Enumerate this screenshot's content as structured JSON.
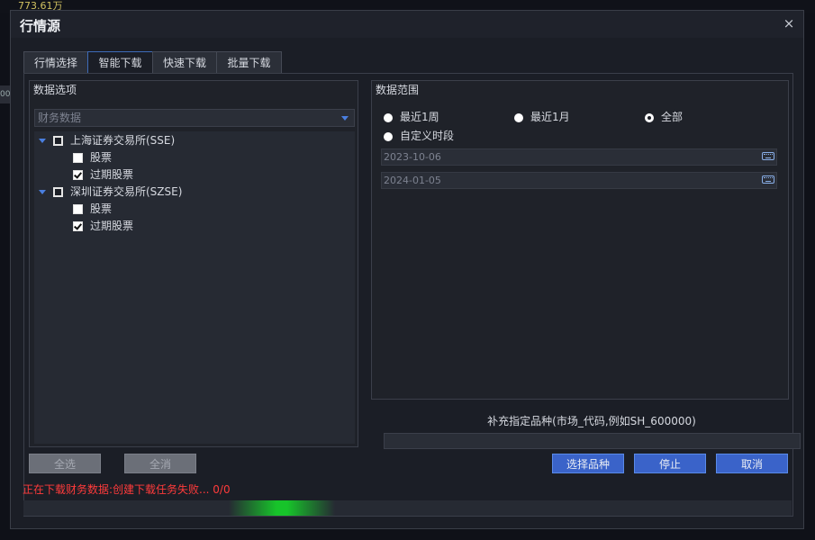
{
  "background": {
    "price_text": "773.61万",
    "left_edge_text": "00"
  },
  "dialog": {
    "title": "行情源",
    "close_symbol": "×",
    "tabs": [
      {
        "label": "行情选择",
        "active": false
      },
      {
        "label": "智能下载",
        "active": true
      },
      {
        "label": "快速下载",
        "active": false
      },
      {
        "label": "批量下载",
        "active": false
      }
    ]
  },
  "data_options": {
    "title": "数据选项",
    "dropdown_value": "财务数据",
    "tree": [
      {
        "label": "上海证券交易所(SSE)",
        "level": 0,
        "state": "partial"
      },
      {
        "label": "股票",
        "level": 1,
        "state": "unchecked"
      },
      {
        "label": "过期股票",
        "level": 1,
        "state": "checked"
      },
      {
        "label": "深圳证券交易所(SZSE)",
        "level": 0,
        "state": "partial"
      },
      {
        "label": "股票",
        "level": 1,
        "state": "unchecked"
      },
      {
        "label": "过期股票",
        "level": 1,
        "state": "checked"
      }
    ]
  },
  "data_range": {
    "title": "数据范围",
    "options": [
      {
        "label": "最近1周",
        "selected": false
      },
      {
        "label": "最近1月",
        "selected": false
      },
      {
        "label": "全部",
        "selected": true
      },
      {
        "label": "自定义时段",
        "selected": false
      }
    ],
    "start_date": "2023-10-06",
    "end_date": "2024-01-05"
  },
  "supplement": {
    "label": "补充指定品种(市场_代码,例如SH_600000)",
    "value": ""
  },
  "buttons": {
    "select_all": "全选",
    "deselect_all": "全消",
    "choose_symbol": "选择品种",
    "stop": "停止",
    "cancel": "取消"
  },
  "status": {
    "message": "正在下载财务数据:创建下载任务失败... 0/0"
  },
  "colors": {
    "accent": "#3a63c9",
    "error": "#ff3b3b",
    "progress": "#17c42a"
  }
}
